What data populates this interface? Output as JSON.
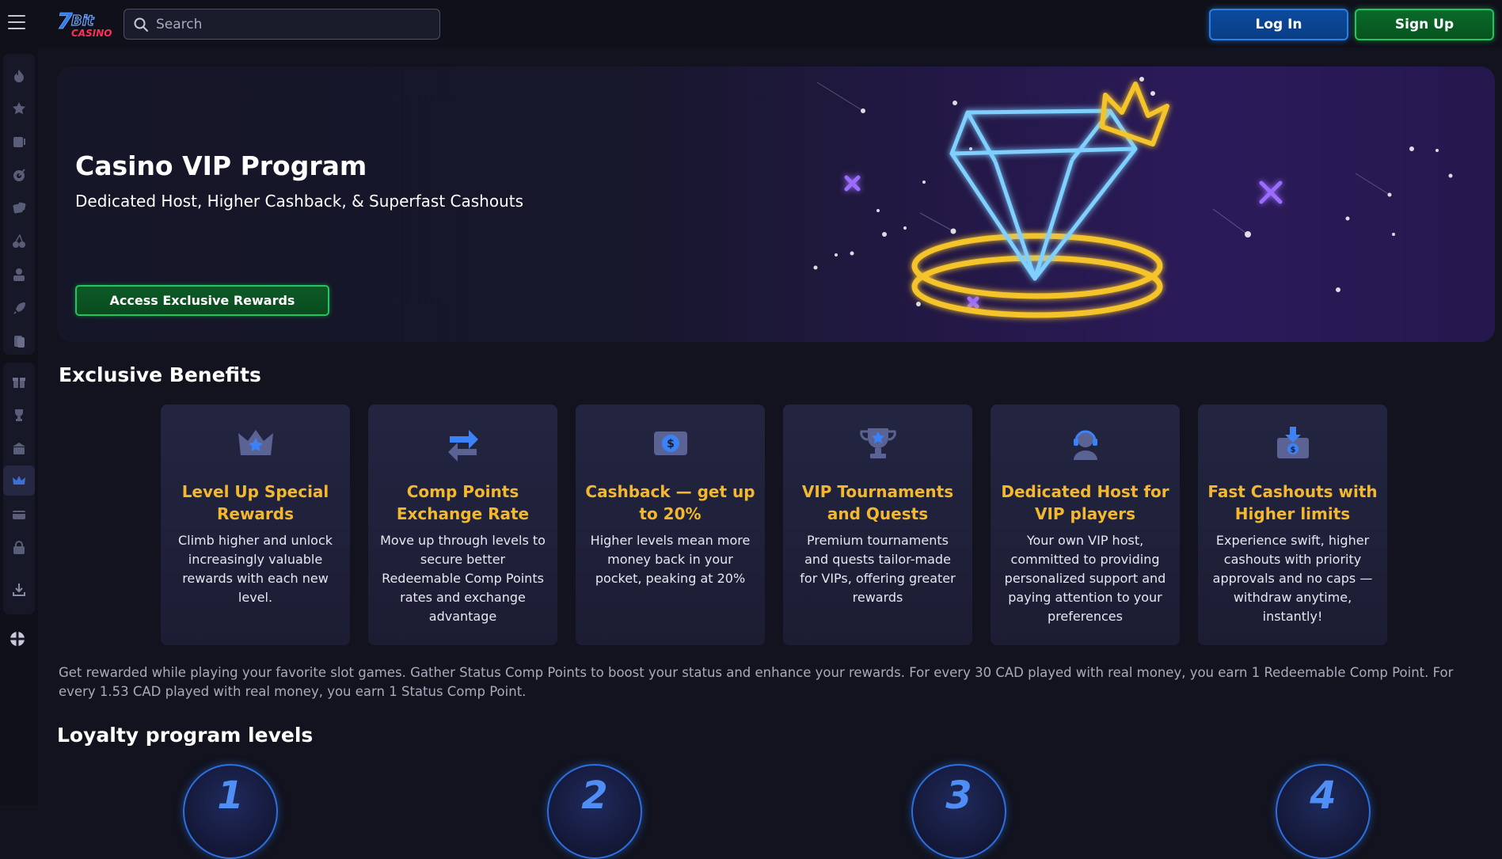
{
  "header": {
    "logo_text": "7Bit CASINO",
    "search_placeholder": "Search",
    "login_label": "Log In",
    "signup_label": "Sign Up"
  },
  "sidebar": {
    "items": [
      "fire-icon",
      "star-icon",
      "slot-icon",
      "target-icon",
      "dice-icon",
      "cherries-icon",
      "dealer-icon",
      "rocket-icon",
      "cards-icon",
      "gift-icon",
      "trophy-icon",
      "bank-icon",
      "crown-icon",
      "wallet-icon",
      "lock-icon",
      "download-icon",
      "flag-icon"
    ]
  },
  "hero": {
    "title": "Casino VIP Program",
    "subtitle": "Dedicated Host, Higher Cashback, & Superfast Cashouts",
    "button_label": "Access Exclusive Rewards"
  },
  "benefits": {
    "title": "Exclusive Benefits",
    "cards": [
      {
        "icon": "crown-icon",
        "title": "Level Up Special Rewards",
        "desc": "Climb higher and unlock increasingly valuable rewards with each new level."
      },
      {
        "icon": "exchange-arrows-icon",
        "title": "Comp Points Exchange Rate",
        "desc": "Move up through levels to secure better Redeemable Comp Points rates and exchange advantage"
      },
      {
        "icon": "cashback-coin-icon",
        "title": "Cashback — get up to 20%",
        "desc": "Higher levels mean more money back in your pocket, peaking at 20%"
      },
      {
        "icon": "trophy-icon",
        "title": "VIP Tournaments and Quests",
        "desc": "Premium tournaments and quests tailor-made for VIPs, offering greater rewards"
      },
      {
        "icon": "headset-icon",
        "title": "Dedicated Host for VIP players",
        "desc": "Your own VIP host, committed to providing personalized support and paying attention to your preferences"
      },
      {
        "icon": "cash-box-icon",
        "title": "Fast Cashouts with Higher limits",
        "desc": "Experience swift, higher cashouts with priority approvals and no caps — withdraw anytime, instantly!"
      }
    ]
  },
  "info_text": "Get rewarded while playing your favorite slot games. Gather Status Comp Points to boost your status and enhance your rewards. For every 30 CAD played with real money, you earn 1 Redeemable Comp Point. For every 1.53 CAD played with real money, you earn 1 Status Comp Point.",
  "loyalty": {
    "title": "Loyalty program levels",
    "levels": [
      "1",
      "2",
      "3",
      "4"
    ]
  },
  "colors": {
    "background": "#12131f",
    "accent_green": "#22c55e",
    "accent_blue": "#2a7fe5",
    "card_title": "#f5b82c"
  }
}
